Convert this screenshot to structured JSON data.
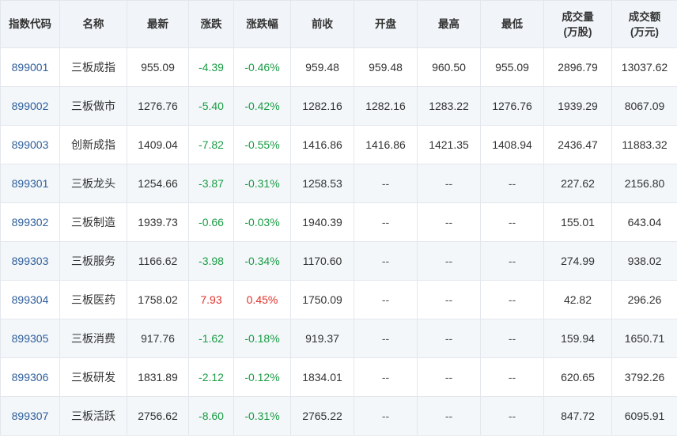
{
  "headers": [
    {
      "key": "code",
      "lines": [
        "指数代码"
      ]
    },
    {
      "key": "name",
      "lines": [
        "名称"
      ]
    },
    {
      "key": "latest",
      "lines": [
        "最新"
      ]
    },
    {
      "key": "change",
      "lines": [
        "涨跌"
      ]
    },
    {
      "key": "change_pct",
      "lines": [
        "涨跌幅"
      ]
    },
    {
      "key": "prev_close",
      "lines": [
        "前收"
      ]
    },
    {
      "key": "open",
      "lines": [
        "开盘"
      ]
    },
    {
      "key": "high",
      "lines": [
        "最高"
      ]
    },
    {
      "key": "low",
      "lines": [
        "最低"
      ]
    },
    {
      "key": "volume",
      "lines": [
        "成交量",
        "(万股)"
      ]
    },
    {
      "key": "turnover",
      "lines": [
        "成交额",
        "(万元)"
      ]
    }
  ],
  "rows": [
    {
      "code": "899001",
      "name": "三板成指",
      "latest": "955.09",
      "change": "-4.39",
      "change_pct": "-0.46%",
      "prev_close": "959.48",
      "open": "959.48",
      "high": "960.50",
      "low": "955.09",
      "volume": "2896.79",
      "turnover": "13037.62",
      "direction": "down"
    },
    {
      "code": "899002",
      "name": "三板做市",
      "latest": "1276.76",
      "change": "-5.40",
      "change_pct": "-0.42%",
      "prev_close": "1282.16",
      "open": "1282.16",
      "high": "1283.22",
      "low": "1276.76",
      "volume": "1939.29",
      "turnover": "8067.09",
      "direction": "down"
    },
    {
      "code": "899003",
      "name": "创新成指",
      "latest": "1409.04",
      "change": "-7.82",
      "change_pct": "-0.55%",
      "prev_close": "1416.86",
      "open": "1416.86",
      "high": "1421.35",
      "low": "1408.94",
      "volume": "2436.47",
      "turnover": "11883.32",
      "direction": "down"
    },
    {
      "code": "899301",
      "name": "三板龙头",
      "latest": "1254.66",
      "change": "-3.87",
      "change_pct": "-0.31%",
      "prev_close": "1258.53",
      "open": "--",
      "high": "--",
      "low": "--",
      "volume": "227.62",
      "turnover": "2156.80",
      "direction": "down"
    },
    {
      "code": "899302",
      "name": "三板制造",
      "latest": "1939.73",
      "change": "-0.66",
      "change_pct": "-0.03%",
      "prev_close": "1940.39",
      "open": "--",
      "high": "--",
      "low": "--",
      "volume": "155.01",
      "turnover": "643.04",
      "direction": "down"
    },
    {
      "code": "899303",
      "name": "三板服务",
      "latest": "1166.62",
      "change": "-3.98",
      "change_pct": "-0.34%",
      "prev_close": "1170.60",
      "open": "--",
      "high": "--",
      "low": "--",
      "volume": "274.99",
      "turnover": "938.02",
      "direction": "down"
    },
    {
      "code": "899304",
      "name": "三板医药",
      "latest": "1758.02",
      "change": "7.93",
      "change_pct": "0.45%",
      "prev_close": "1750.09",
      "open": "--",
      "high": "--",
      "low": "--",
      "volume": "42.82",
      "turnover": "296.26",
      "direction": "up"
    },
    {
      "code": "899305",
      "name": "三板消费",
      "latest": "917.76",
      "change": "-1.62",
      "change_pct": "-0.18%",
      "prev_close": "919.37",
      "open": "--",
      "high": "--",
      "low": "--",
      "volume": "159.94",
      "turnover": "1650.71",
      "direction": "down"
    },
    {
      "code": "899306",
      "name": "三板研发",
      "latest": "1831.89",
      "change": "-2.12",
      "change_pct": "-0.12%",
      "prev_close": "1834.01",
      "open": "--",
      "high": "--",
      "low": "--",
      "volume": "620.65",
      "turnover": "3792.26",
      "direction": "down"
    },
    {
      "code": "899307",
      "name": "三板活跃",
      "latest": "2756.62",
      "change": "-8.60",
      "change_pct": "-0.31%",
      "prev_close": "2765.22",
      "open": "--",
      "high": "--",
      "low": "--",
      "volume": "847.72",
      "turnover": "6095.91",
      "direction": "down"
    }
  ],
  "colors": {
    "up": "#e0302a",
    "down": "#1a9c45",
    "code_link": "#2e5e9a",
    "header_bg": "#f1f5f9",
    "stripe_bg": "#f3f7fa"
  }
}
